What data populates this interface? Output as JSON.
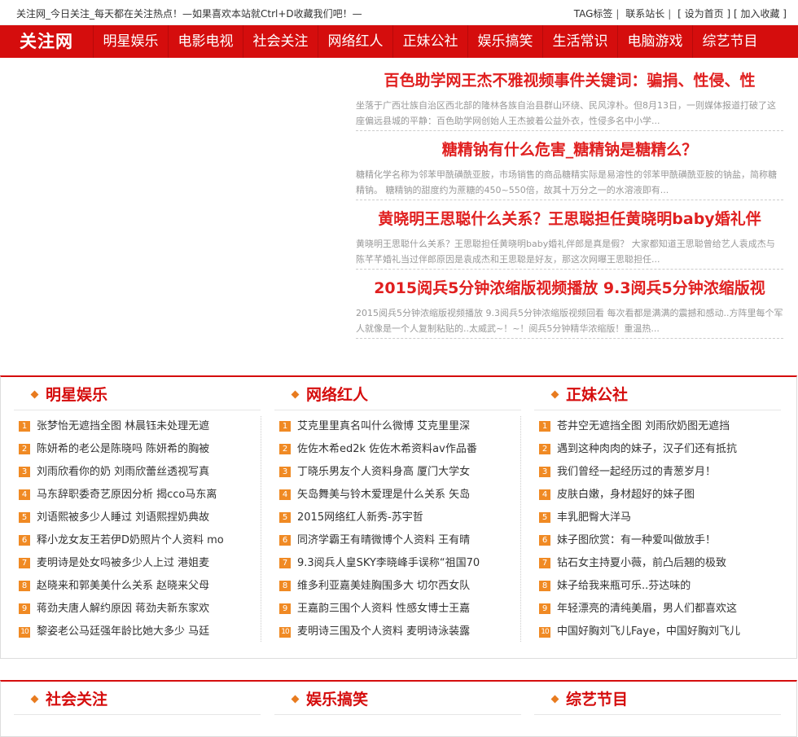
{
  "topbar": {
    "slogan": "关注网_今日关注_每天都在关注热点！—如果喜欢本站就Ctrl+D收藏我们吧！—",
    "links": [
      "TAG标签",
      "联系站长",
      "[ 设为首页 ]",
      "[ 加入收藏 ]"
    ]
  },
  "nav": {
    "logo": "关注网",
    "items": [
      "明星娱乐",
      "电影电视",
      "社会关注",
      "网络红人",
      "正妹公社",
      "娱乐搞笑",
      "生活常识",
      "电脑游戏",
      "综艺节目"
    ]
  },
  "headlines": [
    {
      "title": "百色助学网王杰不雅视频事件关键词：骗捐、性侵、性",
      "summary": "坐落于广西壮族自治区西北部的隆林各族自治县群山环绕、民风淳朴。但8月13日，一则媒体报道打破了这座偏远县城的平静：百色助学网创始人王杰披着公益外衣，性侵多名中小学..."
    },
    {
      "title": "糖精钠有什么危害_糖精钠是糖精么？",
      "summary": "糖精化学名称为邻苯甲酰磺酰亚胺，市场销售的商品糖精实际是易溶性的邻苯甲酰磺酰亚胺的钠盐，简称糖精钠。 糖精钠的甜度约为蔗糖的450~550倍，故其十万分之一的水溶液即有..."
    },
    {
      "title": "黄晓明王思聪什么关系？王思聪担任黄晓明baby婚礼伴",
      "summary": "黄晓明王思聪什么关系？王思聪担任黄晓明baby婚礼伴郎是真是假？ 大家都知道王思聪曾给艺人袁成杰与陈芊芊婚礼当过伴郎原因是袁成杰和王思聪是好友，那这次网曝王思聪担任..."
    },
    {
      "title": "2015阅兵5分钟浓缩版视频播放 9.3阅兵5分钟浓缩版视",
      "summary": "2015阅兵5分钟浓缩版视频播放 9.3阅兵5分钟浓缩版视频回看 每次看都是满满的震撼和感动..方阵里每个军人就像是一个人复制粘贴的..太威武~！~！阅兵5分钟精华浓缩版！重温热..."
    }
  ],
  "sections_row1": [
    {
      "title": "明星娱乐",
      "items": [
        "张梦怡无遮挡全图 林晨钰未处理无遮",
        "陈妍希的老公是陈晓吗 陈妍希的胸被",
        "刘雨欣看你的奶 刘雨欣蕾丝透视写真",
        "马东辞职委奇艺原因分析 揭cco马东离",
        "刘语熙被多少人睡过 刘语熙捏奶典故",
        "释小龙女友王若伊D奶照片个人资料 mo",
        "麦明诗是处女吗被多少人上过 港姐麦",
        "赵晓来和郭美美什么关系 赵晓来父母",
        "蒋劲夫唐人解约原因 蒋劲夫新东家欢",
        "黎姿老公马廷强年龄比她大多少 马廷"
      ]
    },
    {
      "title": "网络红人",
      "items": [
        "艾克里里真名叫什么微博 艾克里里深",
        "佐佐木希ed2k 佐佐木希资料av作品番",
        "丁晓乐男友个人资料身高 厦门大学女",
        "矢岛舞美与铃木爱理是什么关系 矢岛",
        "2015网络红人新秀-苏宇哲",
        "同济学霸王有晴微博个人资料 王有晴",
        "9.3阅兵人皇SKY李晓峰手误称“祖国70",
        "维多利亚嘉美娃胸围多大 切尔西女队",
        "王嘉韵三围个人资料 性感女博士王嘉",
        "麦明诗三围及个人资料 麦明诗泳装露"
      ]
    },
    {
      "title": "正妹公社",
      "items": [
        "苍井空无遮挡全图 刘雨欣奶图无遮挡",
        "遇到这种肉肉的妹子，汉子们还有抵抗",
        "我们曾经一起经历过的青葱岁月！",
        "皮肤白嫩，身材超好的妹子图",
        "丰乳肥臀大洋马",
        "妹子图欣赏：有一种爱叫做放手！",
        "钻石女主持夏小薇，前凸后翘的极致",
        "妹子给我来瓶可乐..芬达味的",
        "年轻漂亮的清纯美眉，男人们都喜欢这",
        "中国好胸刘飞儿Faye，中国好胸刘飞儿"
      ]
    }
  ],
  "sections_row2": [
    {
      "title": "社会关注"
    },
    {
      "title": "娱乐搞笑"
    },
    {
      "title": "综艺节目"
    }
  ],
  "colors": {
    "brand": "#d50d0d",
    "headline": "#e02020",
    "number_badge": "#f08a24"
  }
}
